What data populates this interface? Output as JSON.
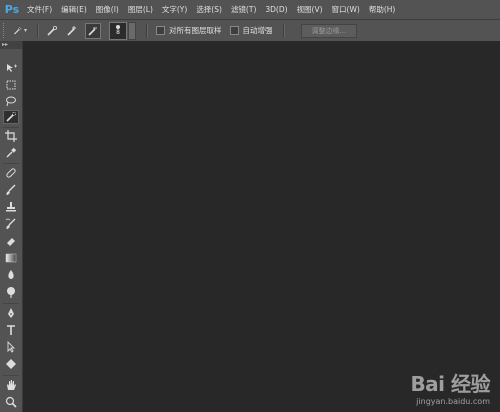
{
  "app": {
    "logo_text": "Ps"
  },
  "menu": [
    "文件(F)",
    "编辑(E)",
    "图像(I)",
    "图层(L)",
    "文字(Y)",
    "选择(S)",
    "滤镜(T)",
    "3D(D)",
    "视图(V)",
    "窗口(W)",
    "帮助(H)"
  ],
  "options": {
    "brush_size": "8",
    "sample_all_layers": {
      "label": "对所有图层取样",
      "checked": false
    },
    "auto_enhance": {
      "label": "自动增强",
      "checked": false
    },
    "refine_edge_label": "调整边缘..."
  },
  "toolbox": {
    "header": "▸▸",
    "tools": [
      "move-tool-icon",
      "marquee-tool-icon",
      "lasso-tool-icon",
      "quick-selection-tool-icon",
      "crop-tool-icon",
      "eyedropper-tool-icon",
      "healing-brush-tool-icon",
      "brush-tool-icon",
      "clone-stamp-tool-icon",
      "history-brush-tool-icon",
      "eraser-tool-icon",
      "gradient-tool-icon",
      "blur-tool-icon",
      "dodge-tool-icon",
      "pen-tool-icon",
      "type-tool-icon",
      "path-selection-tool-icon",
      "shape-tool-icon",
      "hand-tool-icon",
      "zoom-tool-icon"
    ],
    "active_tool": "quick-selection-tool-icon"
  },
  "watermark": {
    "logo": "Bai 经验",
    "url": "jingyan.baidu.com"
  }
}
